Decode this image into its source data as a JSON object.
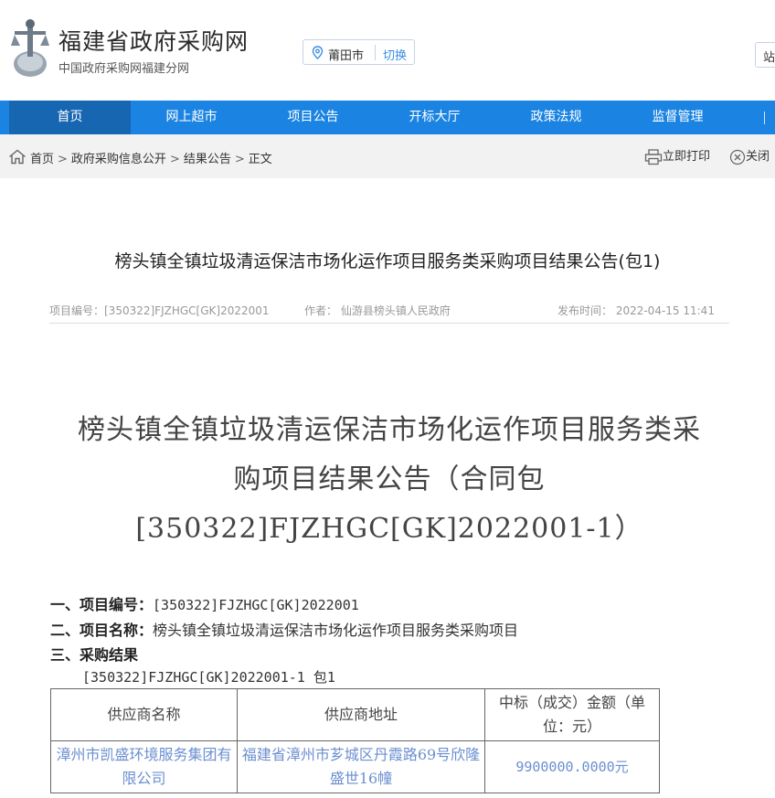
{
  "header": {
    "site_title": "福建省政府采购网",
    "site_subtitle": "中国政府采购网福建分网",
    "city": "莆田市",
    "switch_label": "切换",
    "corner_text": "站"
  },
  "nav": {
    "items": [
      "首页",
      "网上超市",
      "项目公告",
      "开标大厅",
      "政策法规",
      "监督管理"
    ]
  },
  "breadcrumb": {
    "items": [
      "首页",
      "政府采购信息公开",
      "结果公告",
      "正文"
    ],
    "print_label": "立即打印",
    "close_label": "关闭"
  },
  "article": {
    "title": "榜头镇全镇垃圾清运保洁市场化运作项目服务类采购项目结果公告(包1)",
    "project_no": "项目编号：[350322]FJZHGC[GK]2022001",
    "author": "作者： 仙游县榜头镇人民政府",
    "publish_time": "发布时间： 2022-04-15 11:41",
    "big_title_line1": "榜头镇全镇垃圾清运保洁市场化运作项目服务类采",
    "big_title_line2": "购项目结果公告（合同包",
    "big_title_line3": "[350322]FJZHGC[GK]2022001-1）",
    "sec1_key": "一、项目编号：",
    "sec1_val": "[350322]FJZHGC[GK]2022001",
    "sec2_key": "二、项目名称：",
    "sec2_val": "榜头镇全镇垃圾清运保洁市场化运作项目服务类采购项目",
    "sec3_key": "三、采购结果",
    "package": "[350322]FJZHGC[GK]2022001-1 包1"
  },
  "results_table": {
    "headers": [
      "供应商名称",
      "供应商地址",
      "中标（成交）金额（单位：元）"
    ],
    "rows": [
      [
        "漳州市凯盛环境服务集团有限公司",
        "福建省漳州市芗城区丹霞路69号欣隆盛世16幢",
        "9900000.0000元"
      ]
    ]
  },
  "colors": {
    "nav_bg": "#1b84e2",
    "nav_active": "#1766b2",
    "link": "#3a8de0",
    "table_text": "#6b8fd0"
  }
}
